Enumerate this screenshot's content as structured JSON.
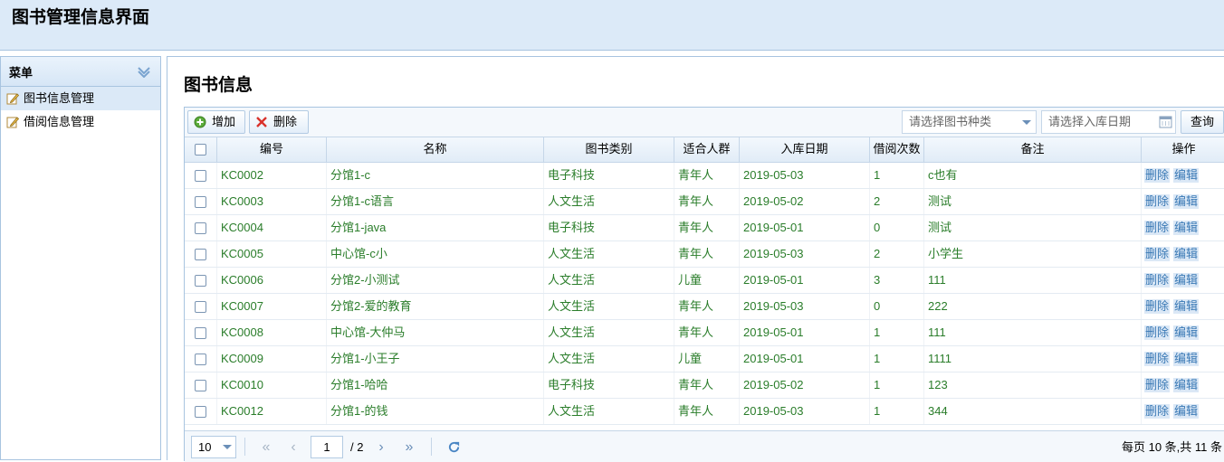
{
  "app": {
    "title": "图书管理信息界面"
  },
  "sidebar": {
    "title": "菜单",
    "items": [
      {
        "label": "图书信息管理",
        "icon": "edit-icon"
      },
      {
        "label": "借阅信息管理",
        "icon": "edit-icon"
      }
    ]
  },
  "main": {
    "title": "图书信息"
  },
  "toolbar": {
    "add_label": "增加",
    "delete_label": "删除",
    "category_placeholder": "请选择图书种类",
    "date_placeholder": "请选择入库日期",
    "search_label": "查询"
  },
  "table": {
    "columns": [
      "编号",
      "名称",
      "图书类别",
      "适合人群",
      "入库日期",
      "借阅次数",
      "备注",
      "操作"
    ],
    "op_delete": "删除",
    "op_edit": "编辑",
    "rows": [
      [
        "KC0002",
        "分馆1-c",
        "电子科技",
        "青年人",
        "2019-05-03",
        "1",
        "c也有"
      ],
      [
        "KC0003",
        "分馆1-c语言",
        "人文生活",
        "青年人",
        "2019-05-02",
        "2",
        "测试"
      ],
      [
        "KC0004",
        "分馆1-java",
        "电子科技",
        "青年人",
        "2019-05-01",
        "0",
        "测试"
      ],
      [
        "KC0005",
        "中心馆-c小",
        "人文生活",
        "青年人",
        "2019-05-03",
        "2",
        "小学生"
      ],
      [
        "KC0006",
        "分馆2-小测试",
        "人文生活",
        "儿童",
        "2019-05-01",
        "3",
        "111"
      ],
      [
        "KC0007",
        "分馆2-爱的教育",
        "人文生活",
        "青年人",
        "2019-05-03",
        "0",
        "222"
      ],
      [
        "KC0008",
        "中心馆-大仲马",
        "人文生活",
        "青年人",
        "2019-05-01",
        "1",
        "111"
      ],
      [
        "KC0009",
        "分馆1-小王子",
        "人文生活",
        "儿童",
        "2019-05-01",
        "1",
        "1111"
      ],
      [
        "KC0010",
        "分馆1-哈哈",
        "电子科技",
        "青年人",
        "2019-05-02",
        "1",
        "123"
      ],
      [
        "KC0012",
        "分馆1-的钱",
        "人文生活",
        "青年人",
        "2019-05-03",
        "1",
        "344"
      ]
    ]
  },
  "pager": {
    "page_size": "10",
    "current_page": "1",
    "total_pages": "/ 2",
    "summary": "每页 10 条,共 11 条"
  },
  "colors": {
    "accent": "#dceaf8",
    "cell_text": "#2a7d2a",
    "border": "#a8c4e0"
  }
}
